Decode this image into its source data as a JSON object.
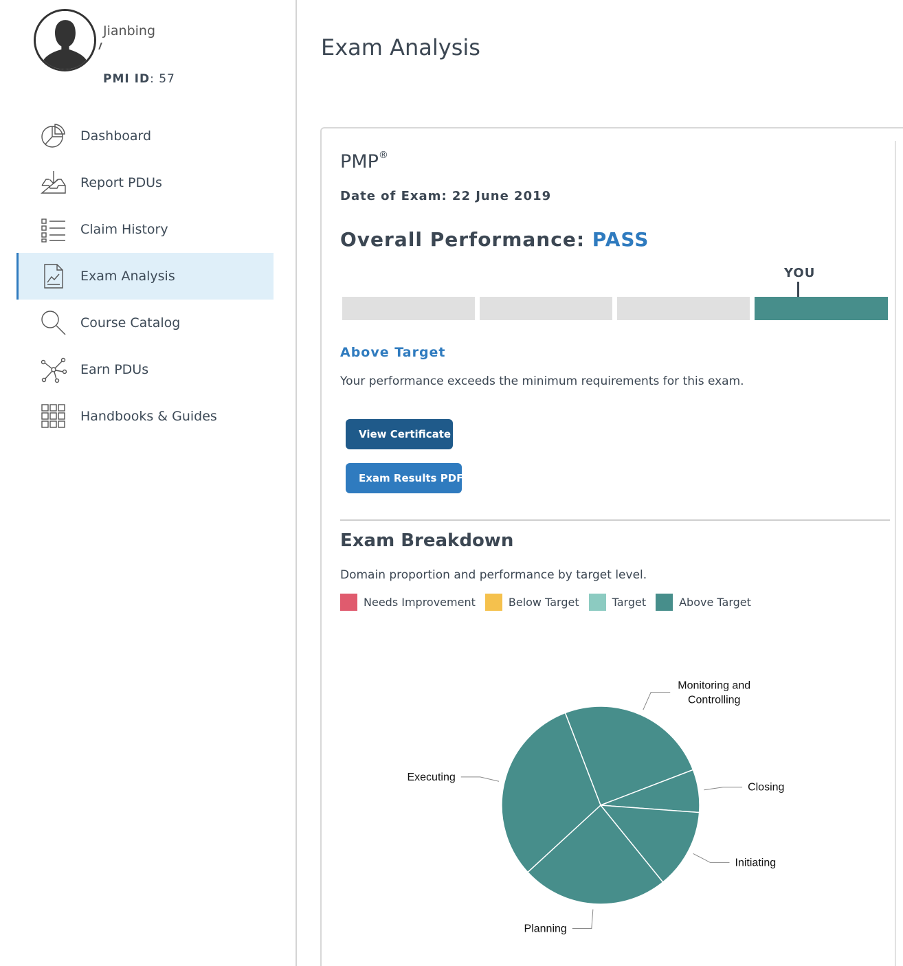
{
  "user": {
    "name": "Jianbing",
    "pmi_id_label": "PMI ID",
    "pmi_id_value": ": 57"
  },
  "nav": {
    "items": [
      {
        "label": "Dashboard",
        "icon": "pie-chart-icon"
      },
      {
        "label": "Report PDUs",
        "icon": "inbox-download-icon"
      },
      {
        "label": "Claim History",
        "icon": "list-icon"
      },
      {
        "label": "Exam Analysis",
        "icon": "document-chart-icon",
        "active": true
      },
      {
        "label": "Course Catalog",
        "icon": "search-icon"
      },
      {
        "label": "Earn PDUs",
        "icon": "network-icon"
      },
      {
        "label": "Handbooks & Guides",
        "icon": "grid-icon"
      }
    ]
  },
  "page": {
    "title": "Exam Analysis"
  },
  "exam": {
    "name": "PMP",
    "registered": "®",
    "date_label": "Date of Exam:",
    "date_value": "22 June 2019",
    "overall_label": "Overall Performance:",
    "overall_result": "PASS",
    "you_label": "YOU",
    "performance_level_index": 3,
    "performance_levels": 4,
    "level_title": "Above Target",
    "level_description": "Your performance exceeds the minimum requirements for this exam."
  },
  "buttons": {
    "view_certificate": "View Certificate",
    "exam_results_pdf": "Exam Results PDF"
  },
  "breakdown": {
    "title": "Exam Breakdown",
    "description": "Domain proportion and performance by target level.",
    "legend": [
      {
        "label": "Needs Improvement",
        "color": "#e05b6e"
      },
      {
        "label": "Below Target",
        "color": "#f5c14d"
      },
      {
        "label": "Target",
        "color": "#8ccbc1"
      },
      {
        "label": "Above Target",
        "color": "#478e8b"
      }
    ]
  },
  "chart_data": {
    "type": "pie",
    "categories": [
      "Monitoring and Controlling",
      "Closing",
      "Initiating",
      "Planning",
      "Executing"
    ],
    "values": [
      25,
      7,
      13,
      24,
      31
    ],
    "level": [
      "Above Target",
      "Above Target",
      "Above Target",
      "Above Target",
      "Above Target"
    ],
    "slice_color": "#478e8b",
    "label_lines": [
      [
        "Monitoring and",
        "Controlling"
      ],
      [
        "Closing"
      ],
      [
        "Initiating"
      ],
      [
        "Planning"
      ],
      [
        "Executing"
      ]
    ]
  }
}
